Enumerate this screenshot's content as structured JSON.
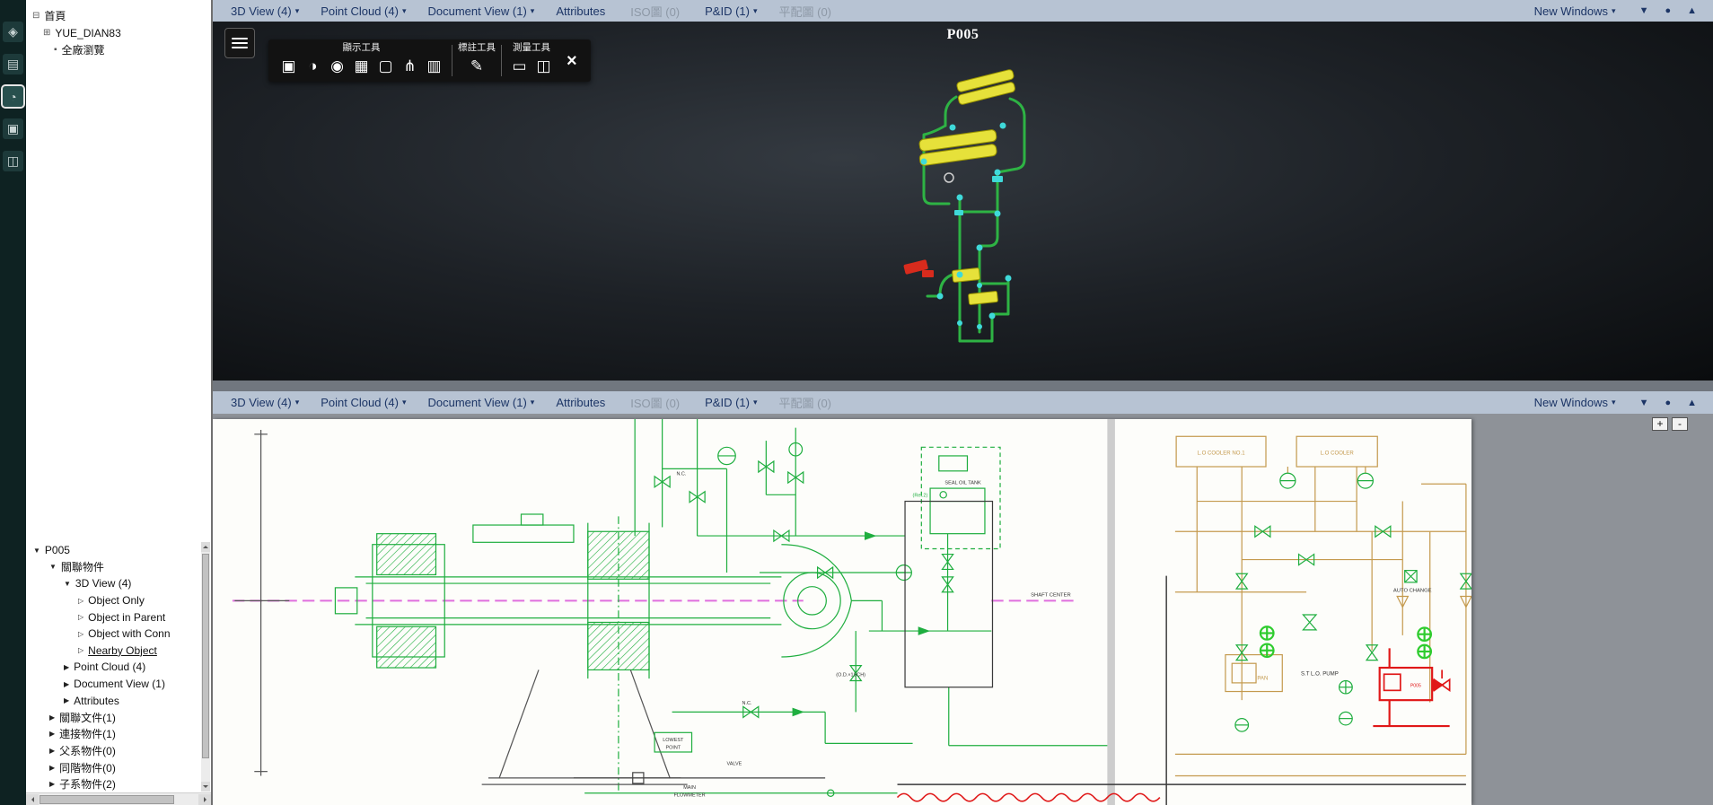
{
  "left_rail": {
    "icons": [
      {
        "name": "model-icon",
        "glyph": "◈",
        "selected": false
      },
      {
        "name": "paint-icon",
        "glyph": "▤",
        "selected": false
      },
      {
        "name": "history-icon",
        "glyph": "◔",
        "selected": true
      },
      {
        "name": "documents-icon",
        "glyph": "▣",
        "selected": false
      },
      {
        "name": "cube-icon",
        "glyph": "◫",
        "selected": false
      }
    ]
  },
  "project_tree": {
    "root_icon": "⊟",
    "root": "首頁",
    "site_icon": "⊞",
    "site": "YUE_DIAN83",
    "plant_icon": "▪",
    "plant": "全廠瀏覽"
  },
  "object_tree": {
    "items": [
      {
        "arrow": "▼",
        "label": "P005",
        "indent": 8,
        "link": false
      },
      {
        "arrow": "▼",
        "label": "關聯物件",
        "indent": 26,
        "link": false
      },
      {
        "arrow": "▼",
        "label": "3D View (4)",
        "indent": 42,
        "link": false
      },
      {
        "arrow": "▷",
        "label": "Object Only",
        "indent": 58,
        "link": false
      },
      {
        "arrow": "▷",
        "label": "Object in Parent",
        "indent": 58,
        "link": false
      },
      {
        "arrow": "▷",
        "label": "Object with Conn",
        "indent": 58,
        "link": false
      },
      {
        "arrow": "▷",
        "label": "Nearby Object",
        "indent": 58,
        "link": true
      },
      {
        "arrow": "▶",
        "label": "Point Cloud (4)",
        "indent": 42,
        "link": false
      },
      {
        "arrow": "▶",
        "label": "Document View (1)",
        "indent": 42,
        "link": false
      },
      {
        "arrow": "▶",
        "label": "Attributes",
        "indent": 42,
        "link": false
      },
      {
        "arrow": "▶",
        "label": "關聯文件(1)",
        "indent": 26,
        "link": false
      },
      {
        "arrow": "▶",
        "label": "連接物件(1)",
        "indent": 26,
        "link": false
      },
      {
        "arrow": "▶",
        "label": "父系物件(0)",
        "indent": 26,
        "link": false
      },
      {
        "arrow": "▶",
        "label": "同階物件(0)",
        "indent": 26,
        "link": false
      },
      {
        "arrow": "▶",
        "label": "子系物件(2)",
        "indent": 26,
        "link": false
      }
    ]
  },
  "menubar": {
    "items": [
      {
        "label": "3D View (4)",
        "caret": "▾",
        "dis": false
      },
      {
        "label": "Point Cloud (4)",
        "caret": "▾",
        "dis": false
      },
      {
        "label": "Document View (1)",
        "caret": "▾",
        "dis": false
      },
      {
        "label": "Attributes",
        "caret": "",
        "dis": false
      },
      {
        "label": "ISO圖 (0)",
        "caret": "",
        "dis": true
      },
      {
        "label": "P&ID (1)",
        "caret": "▾",
        "dis": false
      },
      {
        "label": "平配圖 (0)",
        "caret": "",
        "dis": true
      }
    ],
    "new_windows": "New Windows",
    "new_windows_caret": "▾",
    "window_controls": [
      "▼",
      "●",
      "▲"
    ]
  },
  "viewport_3d": {
    "title": "P005",
    "toolbar": {
      "groups": [
        {
          "title": "顯示工具",
          "icons": [
            {
              "name": "crop-tool-icon",
              "glyph": "▣"
            },
            {
              "name": "contrast-tool-icon",
              "glyph": "◑"
            },
            {
              "name": "visibility-tool-icon",
              "glyph": "◉"
            },
            {
              "name": "snapshot-tool-icon",
              "glyph": "▦"
            },
            {
              "name": "marquee-tool-icon",
              "glyph": "▢"
            },
            {
              "name": "pipeline-tool-icon",
              "glyph": "⋔"
            },
            {
              "name": "layers-tool-icon",
              "glyph": "▥"
            }
          ]
        },
        {
          "title": "標註工具",
          "icons": [
            {
              "name": "annotate-tool-icon",
              "glyph": "✎"
            }
          ]
        },
        {
          "title": "測量工具",
          "icons": [
            {
              "name": "measure-tape-icon",
              "glyph": "▭"
            },
            {
              "name": "measure-cube-icon",
              "glyph": "◫"
            }
          ]
        }
      ],
      "close": "×"
    }
  },
  "pid": {
    "zoom_in": "+",
    "zoom_out": "-",
    "labels": {
      "seal_oil_tank": "SEAL OIL TANK",
      "ref2": "(Ref.2)",
      "cooler1": "L.O COOLER NO.1",
      "cooler2": "L.O COOLER",
      "auto_change": "AUTO CHANGE",
      "st_lo_pump": "S.T L.O. PUMP",
      "pump_tag": "P005",
      "pan": "PAN",
      "shaft_center": "SHAFT CENTER",
      "nc1": "N.C.",
      "nc2": "N.C.",
      "od_sch": "(O.D.×1SCH)",
      "lowest": "LOWEST",
      "point": "POINT",
      "main": "MAIN",
      "flowmeter": "FLOWMETER",
      "valve": "VALVE"
    }
  }
}
